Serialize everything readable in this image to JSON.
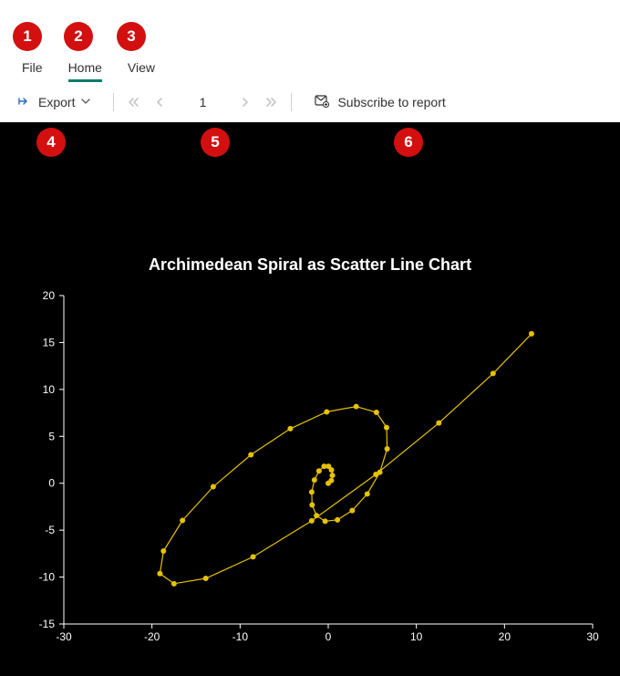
{
  "menu": {
    "tabs": [
      {
        "label": "File",
        "active": false
      },
      {
        "label": "Home",
        "active": true
      },
      {
        "label": "View",
        "active": false
      }
    ]
  },
  "toolbar": {
    "export_label": "Export",
    "page_number": "1",
    "subscribe_label": "Subscribe to report"
  },
  "annotations": {
    "b1": "1",
    "b2": "2",
    "b3": "3",
    "b4": "4",
    "b5": "5",
    "b6": "6"
  },
  "colors": {
    "accent": "#0e7c6b",
    "badge": "#d40f0f",
    "spiral": "#e6c200",
    "chart_bg": "#000000"
  },
  "chart_data": {
    "type": "scatter",
    "title": "Archimedean Spiral as Scatter Line Chart",
    "xlabel": "",
    "ylabel": "",
    "xlim": [
      -30,
      30
    ],
    "ylim": [
      -15,
      20
    ],
    "xticks": [
      -30,
      -20,
      -10,
      0,
      10,
      20,
      30
    ],
    "yticks": [
      -15,
      -10,
      -5,
      0,
      5,
      10,
      15,
      20
    ],
    "series": [
      {
        "name": "spiral",
        "connect": true,
        "x": [
          0.0,
          0.35,
          0.471,
          0.366,
          0.035,
          -0.469,
          -1.049,
          -1.569,
          -1.876,
          -1.829,
          -1.332,
          -0.355,
          1.047,
          2.722,
          4.426,
          5.854,
          6.682,
          6.619,
          5.468,
          3.17,
          -0.176,
          -4.301,
          -8.772,
          -13.046,
          -16.536,
          -18.696,
          -19.097,
          -17.498,
          -13.893,
          -8.527,
          -1.876,
          5.404,
          12.55,
          18.705,
          23.064
        ],
        "y": [
          0.0,
          0.294,
          0.841,
          1.423,
          1.809,
          1.805,
          1.308,
          0.344,
          -0.944,
          -2.307,
          -3.441,
          -4.048,
          -3.902,
          -2.91,
          -1.14,
          1.17,
          3.669,
          5.939,
          7.559,
          8.181,
          7.603,
          5.816,
          3.032,
          -0.368,
          -3.96,
          -7.227,
          -9.632,
          -10.707,
          -10.139,
          -7.842,
          -4.0,
          0.942,
          6.42,
          11.694,
          15.925
        ]
      }
    ]
  }
}
